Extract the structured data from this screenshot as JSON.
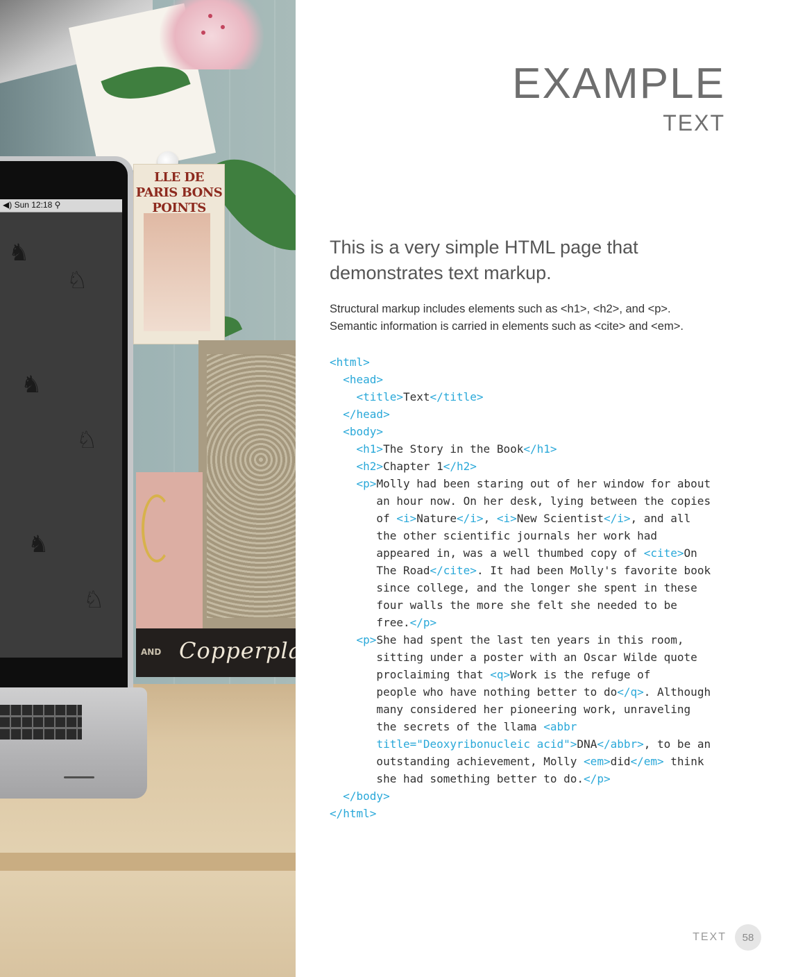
{
  "header": {
    "title": "EXAMPLE",
    "subtitle": "TEXT"
  },
  "photo": {
    "menubar_clock": "Sun 12:18",
    "postcard_title": "LLE DE PARIS BONS POINTS",
    "book_spine_label": "Copperpla",
    "book_spine_prefix": "AND"
  },
  "intro": {
    "lines": [
      "This is a very simple HTML page that",
      "demonstrates text markup."
    ]
  },
  "description": {
    "lines": [
      "Structural markup includes elements such as <h1>, <h2>, and <p>.",
      "Semantic information is carried in elements such as <cite> and <em>."
    ]
  },
  "code": {
    "lines": [
      [
        [
          "t",
          "<html>"
        ]
      ],
      [
        [
          "x",
          "  "
        ],
        [
          "t",
          "<head>"
        ]
      ],
      [
        [
          "x",
          "    "
        ],
        [
          "t",
          "<title>"
        ],
        [
          "x",
          "Text"
        ],
        [
          "t",
          "</title>"
        ]
      ],
      [
        [
          "x",
          "  "
        ],
        [
          "t",
          "</head>"
        ]
      ],
      [
        [
          "x",
          "  "
        ],
        [
          "t",
          "<body>"
        ]
      ],
      [
        [
          "x",
          "    "
        ],
        [
          "t",
          "<h1>"
        ],
        [
          "x",
          "The Story in the Book"
        ],
        [
          "t",
          "</h1>"
        ]
      ],
      [
        [
          "x",
          "    "
        ],
        [
          "t",
          "<h2>"
        ],
        [
          "x",
          "Chapter 1"
        ],
        [
          "t",
          "</h2>"
        ]
      ],
      [
        [
          "x",
          "    "
        ],
        [
          "t",
          "<p>"
        ],
        [
          "x",
          "Molly had been staring out of her window for about"
        ]
      ],
      [
        [
          "x",
          "       an hour now. On her desk, lying between the copies"
        ]
      ],
      [
        [
          "x",
          "       of "
        ],
        [
          "t",
          "<i>"
        ],
        [
          "x",
          "Nature"
        ],
        [
          "t",
          "</i>"
        ],
        [
          "x",
          ", "
        ],
        [
          "t",
          "<i>"
        ],
        [
          "x",
          "New Scientist"
        ],
        [
          "t",
          "</i>"
        ],
        [
          "x",
          ", and all"
        ]
      ],
      [
        [
          "x",
          "       the other scientific journals her work had"
        ]
      ],
      [
        [
          "x",
          "       appeared in, was a well thumbed copy of "
        ],
        [
          "t",
          "<cite>"
        ],
        [
          "x",
          "On"
        ]
      ],
      [
        [
          "x",
          "       The Road"
        ],
        [
          "t",
          "</cite>"
        ],
        [
          "x",
          ". It had been Molly's favorite book"
        ]
      ],
      [
        [
          "x",
          "       since college, and the longer she spent in these"
        ]
      ],
      [
        [
          "x",
          "       four walls the more she felt she needed to be"
        ]
      ],
      [
        [
          "x",
          "       free."
        ],
        [
          "t",
          "</p>"
        ]
      ],
      [
        [
          "x",
          "    "
        ],
        [
          "t",
          "<p>"
        ],
        [
          "x",
          "She had spent the last ten years in this room,"
        ]
      ],
      [
        [
          "x",
          "       sitting under a poster with an Oscar Wilde quote"
        ]
      ],
      [
        [
          "x",
          "       proclaiming that "
        ],
        [
          "t",
          "<q>"
        ],
        [
          "x",
          "Work is the refuge of"
        ]
      ],
      [
        [
          "x",
          "       people who have nothing better to do"
        ],
        [
          "t",
          "</q>"
        ],
        [
          "x",
          ". Although"
        ]
      ],
      [
        [
          "x",
          "       many considered her pioneering work, unraveling"
        ]
      ],
      [
        [
          "x",
          "       the secrets of the llama "
        ],
        [
          "t",
          "<abbr"
        ]
      ],
      [
        [
          "x",
          "       "
        ],
        [
          "t",
          "title=\"Deoxyribonucleic acid\">"
        ],
        [
          "x",
          "DNA"
        ],
        [
          "t",
          "</abbr>"
        ],
        [
          "x",
          ", to be an"
        ]
      ],
      [
        [
          "x",
          "       outstanding achievement, Molly "
        ],
        [
          "t",
          "<em>"
        ],
        [
          "x",
          "did"
        ],
        [
          "t",
          "</em>"
        ],
        [
          "x",
          " think"
        ]
      ],
      [
        [
          "x",
          "       she had something better to do."
        ],
        [
          "t",
          "</p>"
        ]
      ],
      [
        [
          "x",
          "  "
        ],
        [
          "t",
          "</body>"
        ]
      ],
      [
        [
          "t",
          "</html>"
        ]
      ]
    ]
  },
  "footer": {
    "section_label": "TEXT",
    "page_number": "58"
  },
  "colors": {
    "code_tag": "#29a8d9",
    "title_gray": "#6e6e6e",
    "body_text": "#333333"
  }
}
